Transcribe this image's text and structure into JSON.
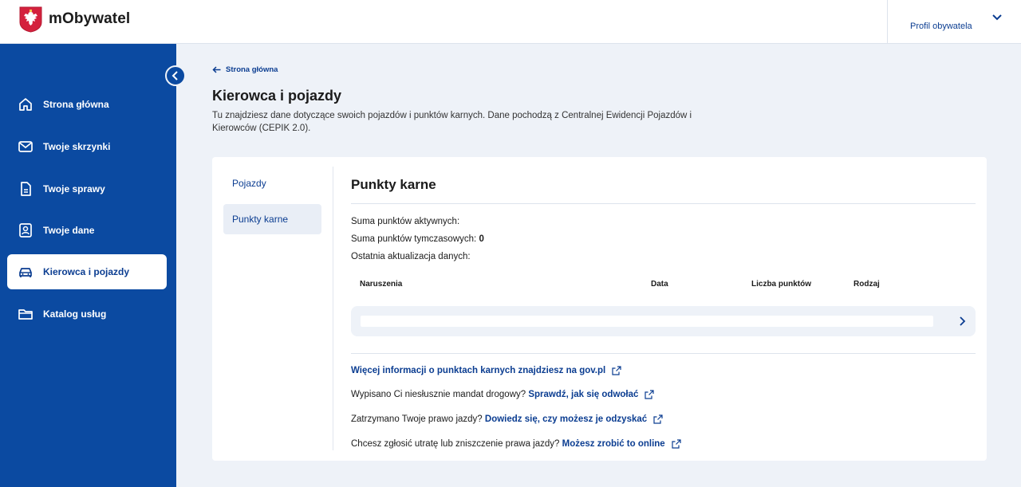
{
  "header": {
    "brand": "mObywatel",
    "profile_label": "Profil obywatela",
    "icons": {
      "logo": "polish-eagle-logo",
      "profile_chevron": "chevron-down-icon"
    }
  },
  "sidebar": {
    "collapse_icon": "chevron-left-icon",
    "items": [
      {
        "label": "Strona główna",
        "icon": "home-icon",
        "active": false
      },
      {
        "label": "Twoje skrzynki",
        "icon": "mail-icon",
        "active": false
      },
      {
        "label": "Twoje sprawy",
        "icon": "document-icon",
        "active": false
      },
      {
        "label": "Twoje dane",
        "icon": "id-card-icon",
        "active": false
      },
      {
        "label": "Kierowca i pojazdy",
        "icon": "car-icon",
        "active": true
      },
      {
        "label": "Katalog usług",
        "icon": "folder-icon",
        "active": false
      }
    ]
  },
  "main": {
    "back_label": "Strona główna",
    "title": "Kierowca i pojazdy",
    "description": "Tu znajdziesz dane dotyczące swoich pojazdów i punktów karnych. Dane pochodzą z Centralnej Ewidencji Pojazdów i Kierowców (CEPIK 2.0).",
    "tabs": [
      {
        "label": "Pojazdy",
        "active": false
      },
      {
        "label": "Punkty karne",
        "active": true
      }
    ],
    "section_title": "Punkty karne",
    "info": {
      "active_points_label": "Suma punktów aktywnych:",
      "temp_points_label": "Suma punktów tymczasowych:",
      "temp_points_value": "0",
      "last_update_label": "Ostatnia aktualizacja danych:"
    },
    "table": {
      "headers": [
        "Naruszenia",
        "Data",
        "Liczba punktów",
        "Rodzaj"
      ]
    },
    "links": [
      {
        "prefix": "",
        "link": "Więcej informacji o punktach karnych znajdziesz na gov.pl"
      },
      {
        "prefix": "Wypisano Ci niesłusznie mandat drogowy?",
        "link": "Sprawdź, jak się odwołać"
      },
      {
        "prefix": "Zatrzymano Twoje prawo jazdy?",
        "link": "Dowiedz się, czy możesz je odzyskać"
      },
      {
        "prefix": "Chcesz zgłosić utratę lub zniszczenie prawa jazdy?",
        "link": "Możesz zrobić to online"
      }
    ]
  },
  "colors": {
    "primary": "#0b4aa1",
    "link": "#0b3d91",
    "background": "#eef2f8",
    "eagle_red": "#d4213d"
  }
}
